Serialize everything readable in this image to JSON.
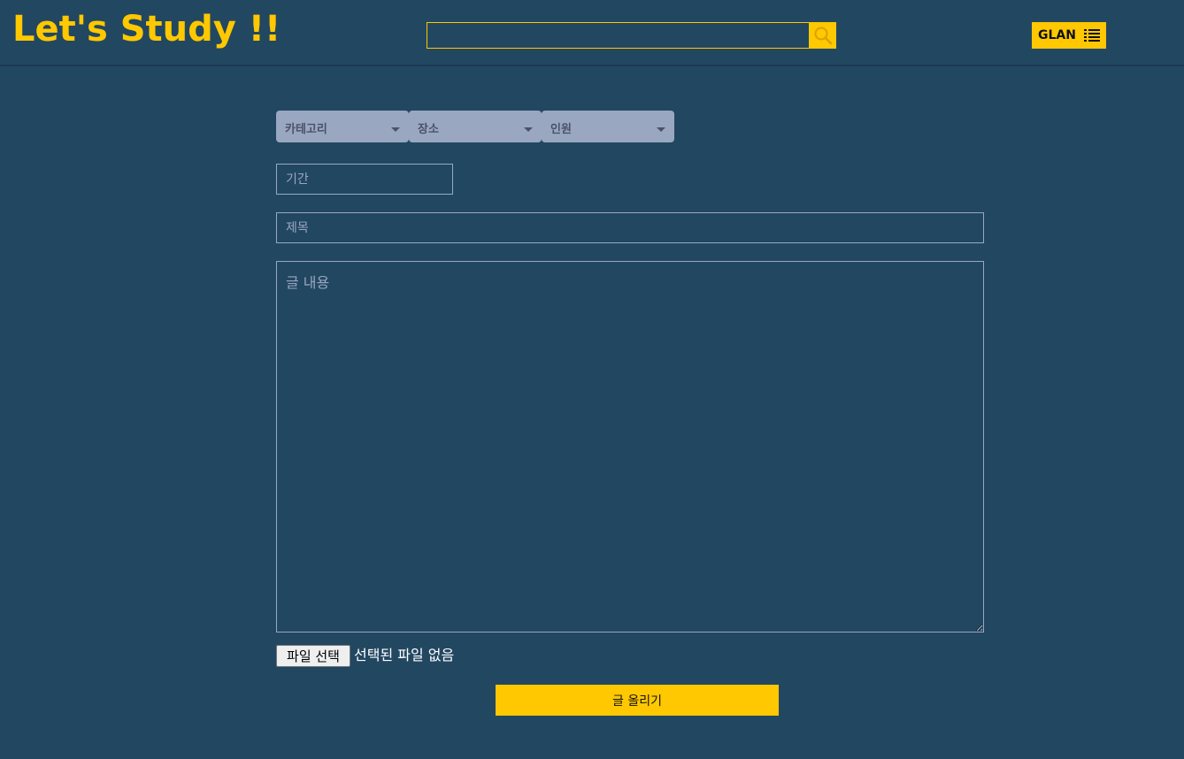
{
  "header": {
    "logo": "Let's Study !!",
    "search": {
      "value": "",
      "placeholder": "",
      "icon": "search-icon"
    },
    "user_button": {
      "label": "GLAN",
      "icon": "list-icon"
    }
  },
  "filters": [
    {
      "label": "카테고리",
      "icon": "caret-down-icon"
    },
    {
      "label": "장소",
      "icon": "caret-down-icon"
    },
    {
      "label": "인원",
      "icon": "caret-down-icon"
    }
  ],
  "form": {
    "period_placeholder": "기간",
    "title_placeholder": "제목",
    "content_placeholder": "글 내용",
    "file_button_label": "파일 선택",
    "file_status": "선택된 파일 없음",
    "submit_label": "글 올리기"
  },
  "colors": {
    "background": "#224761",
    "accent": "#ffc800",
    "select_bg": "#9aa7c1"
  }
}
